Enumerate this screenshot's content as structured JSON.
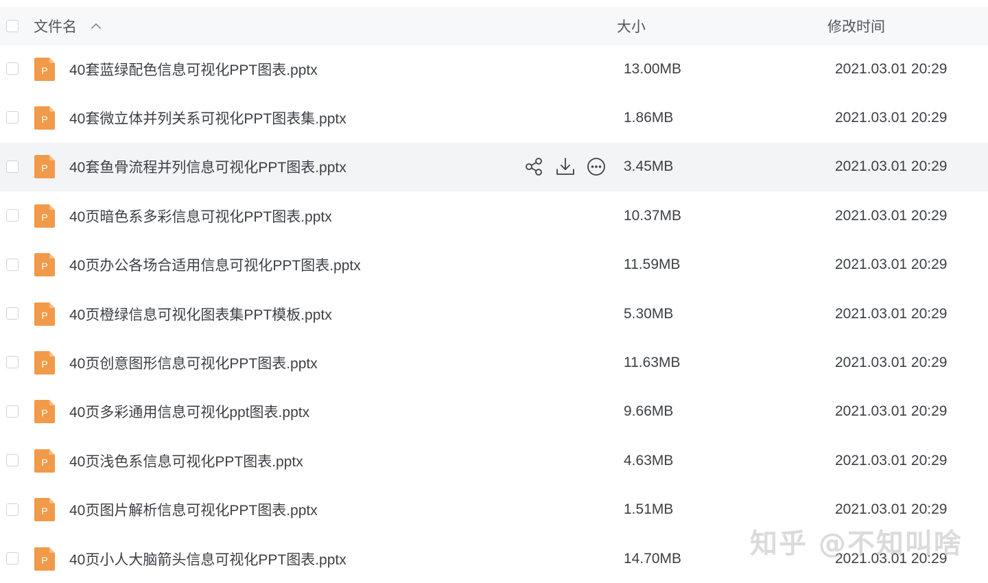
{
  "header": {
    "name_label": "文件名",
    "size_label": "大小",
    "time_label": "修改时间"
  },
  "colors": {
    "file_icon_bg": "#f19a4a",
    "hover_row_bg": "#f3f4f6",
    "header_bg": "#f7f8fa"
  },
  "files": [
    {
      "name": "40套蓝绿配色信息可视化PPT图表.pptx",
      "size": "13.00MB",
      "modified": "2021.03.01 20:29",
      "icon": "ppt-file-icon",
      "icon_letter": "P"
    },
    {
      "name": "40套微立体并列关系可视化PPT图表集.pptx",
      "size": "1.86MB",
      "modified": "2021.03.01 20:29",
      "icon": "ppt-file-icon",
      "icon_letter": "P"
    },
    {
      "name": "40套鱼骨流程并列信息可视化PPT图表.pptx",
      "size": "3.45MB",
      "modified": "2021.03.01 20:29",
      "icon": "ppt-file-icon",
      "icon_letter": "P",
      "hovered": true
    },
    {
      "name": "40页暗色系多彩信息可视化PPT图表.pptx",
      "size": "10.37MB",
      "modified": "2021.03.01 20:29",
      "icon": "ppt-file-icon",
      "icon_letter": "P"
    },
    {
      "name": "40页办公各场合适用信息可视化PPT图表.pptx",
      "size": "11.59MB",
      "modified": "2021.03.01 20:29",
      "icon": "ppt-file-icon",
      "icon_letter": "P"
    },
    {
      "name": "40页橙绿信息可视化图表集PPT模板.pptx",
      "size": "5.30MB",
      "modified": "2021.03.01 20:29",
      "icon": "ppt-file-icon",
      "icon_letter": "P"
    },
    {
      "name": "40页创意图形信息可视化PPT图表.pptx",
      "size": "11.63MB",
      "modified": "2021.03.01 20:29",
      "icon": "ppt-file-icon",
      "icon_letter": "P"
    },
    {
      "name": "40页多彩通用信息可视化ppt图表.pptx",
      "size": "9.66MB",
      "modified": "2021.03.01 20:29",
      "icon": "ppt-file-icon",
      "icon_letter": "P"
    },
    {
      "name": "40页浅色系信息可视化PPT图表.pptx",
      "size": "4.63MB",
      "modified": "2021.03.01 20:29",
      "icon": "ppt-file-icon",
      "icon_letter": "P"
    },
    {
      "name": "40页图片解析信息可视化PPT图表.pptx",
      "size": "1.51MB",
      "modified": "2021.03.01 20:29",
      "icon": "ppt-file-icon",
      "icon_letter": "P"
    },
    {
      "name": "40页小人大脑箭头信息可视化PPT图表.pptx",
      "size": "14.70MB",
      "modified": "2021.03.01 20:29",
      "icon": "ppt-file-icon",
      "icon_letter": "P"
    }
  ],
  "row_actions": {
    "share_icon": "share-icon",
    "download_icon": "download-icon",
    "more_icon": "more-icon"
  },
  "watermark": "知乎 @不知叫啥"
}
